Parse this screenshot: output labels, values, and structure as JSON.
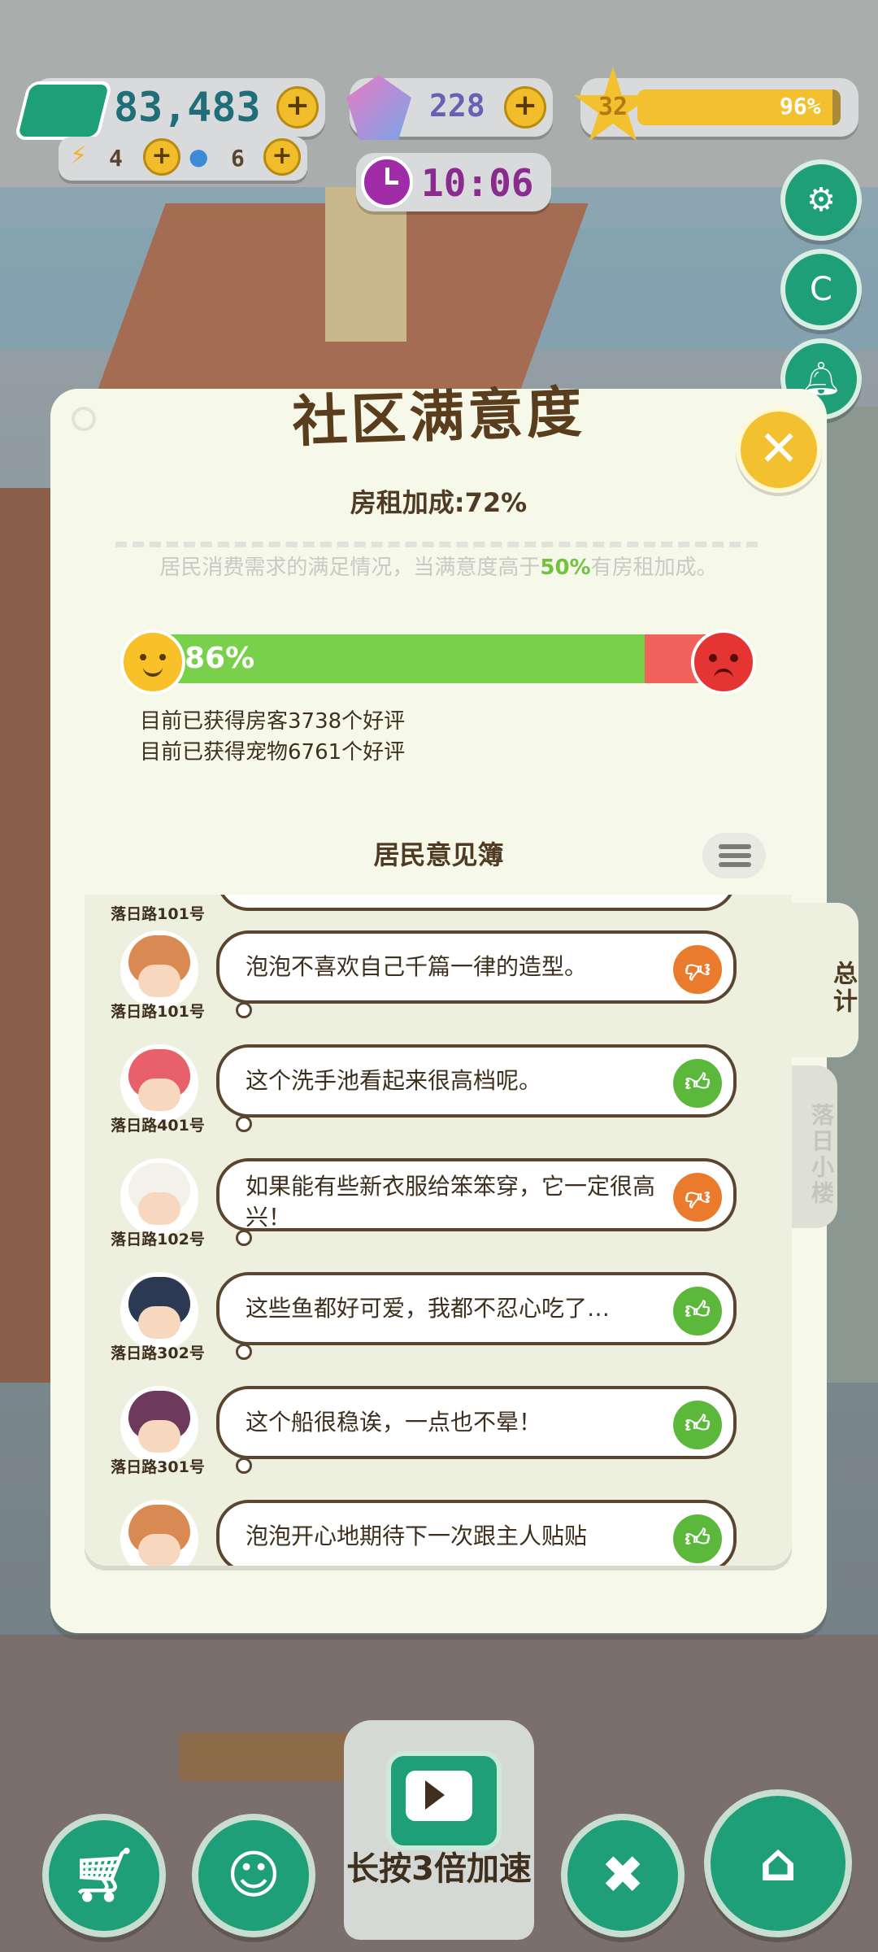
{
  "hud": {
    "cash": "83,483",
    "energy": "4",
    "water": "6",
    "gems": "228",
    "level": "32",
    "level_progress_text": "96%",
    "level_progress": 0.96,
    "timer": "10:06",
    "plus": "+"
  },
  "panel": {
    "title": "社区满意度",
    "close": "✕",
    "rent_bonus": "房租加成:72%",
    "description_before": "居民消费需求的满足情况，当满意度高于",
    "description_highlight": "50%",
    "description_after": "有房租加成。",
    "satisfaction_text": "86%",
    "satisfaction": 0.86,
    "guest_reviews": "目前已获得房客3738个好评",
    "pet_reviews": "目前已获得宠物6761个好评",
    "book_title": "居民意见簿"
  },
  "tabs": {
    "total": "总计",
    "building": "落日小楼"
  },
  "comments": [
    {
      "address": "落日路101号",
      "text": "泡泡不喜欢自己千篇一律的造型。",
      "rating": "negative",
      "avatar_color": "#d98a52"
    },
    {
      "address": "落日路401号",
      "text": "这个洗手池看起来很高档呢。",
      "rating": "positive",
      "avatar_color": "#e8606a"
    },
    {
      "address": "落日路102号",
      "text": "如果能有些新衣服给笨笨穿，它一定很高兴！",
      "rating": "negative",
      "avatar_color": "#f3f1ea"
    },
    {
      "address": "落日路302号",
      "text": "这些鱼都好可爱，我都不忍心吃了…",
      "rating": "positive",
      "avatar_color": "#2b3a52"
    },
    {
      "address": "落日路301号",
      "text": "这个船很稳诶，一点也不晕！",
      "rating": "positive",
      "avatar_color": "#6d3a5e"
    },
    {
      "address": "",
      "text": "泡泡开心地期待下一次跟主人贴贴",
      "rating": "positive",
      "avatar_color": "#d98a52"
    }
  ],
  "top_partial_address": "落日路101号",
  "bottom": {
    "speed_label": "长按3倍加速"
  },
  "colors": {
    "brand_green": "#1e9f78",
    "bar_green": "#79d04a",
    "bar_red": "#f2625c",
    "gold": "#f3c12f",
    "panel_bg": "#f6f8ea"
  }
}
